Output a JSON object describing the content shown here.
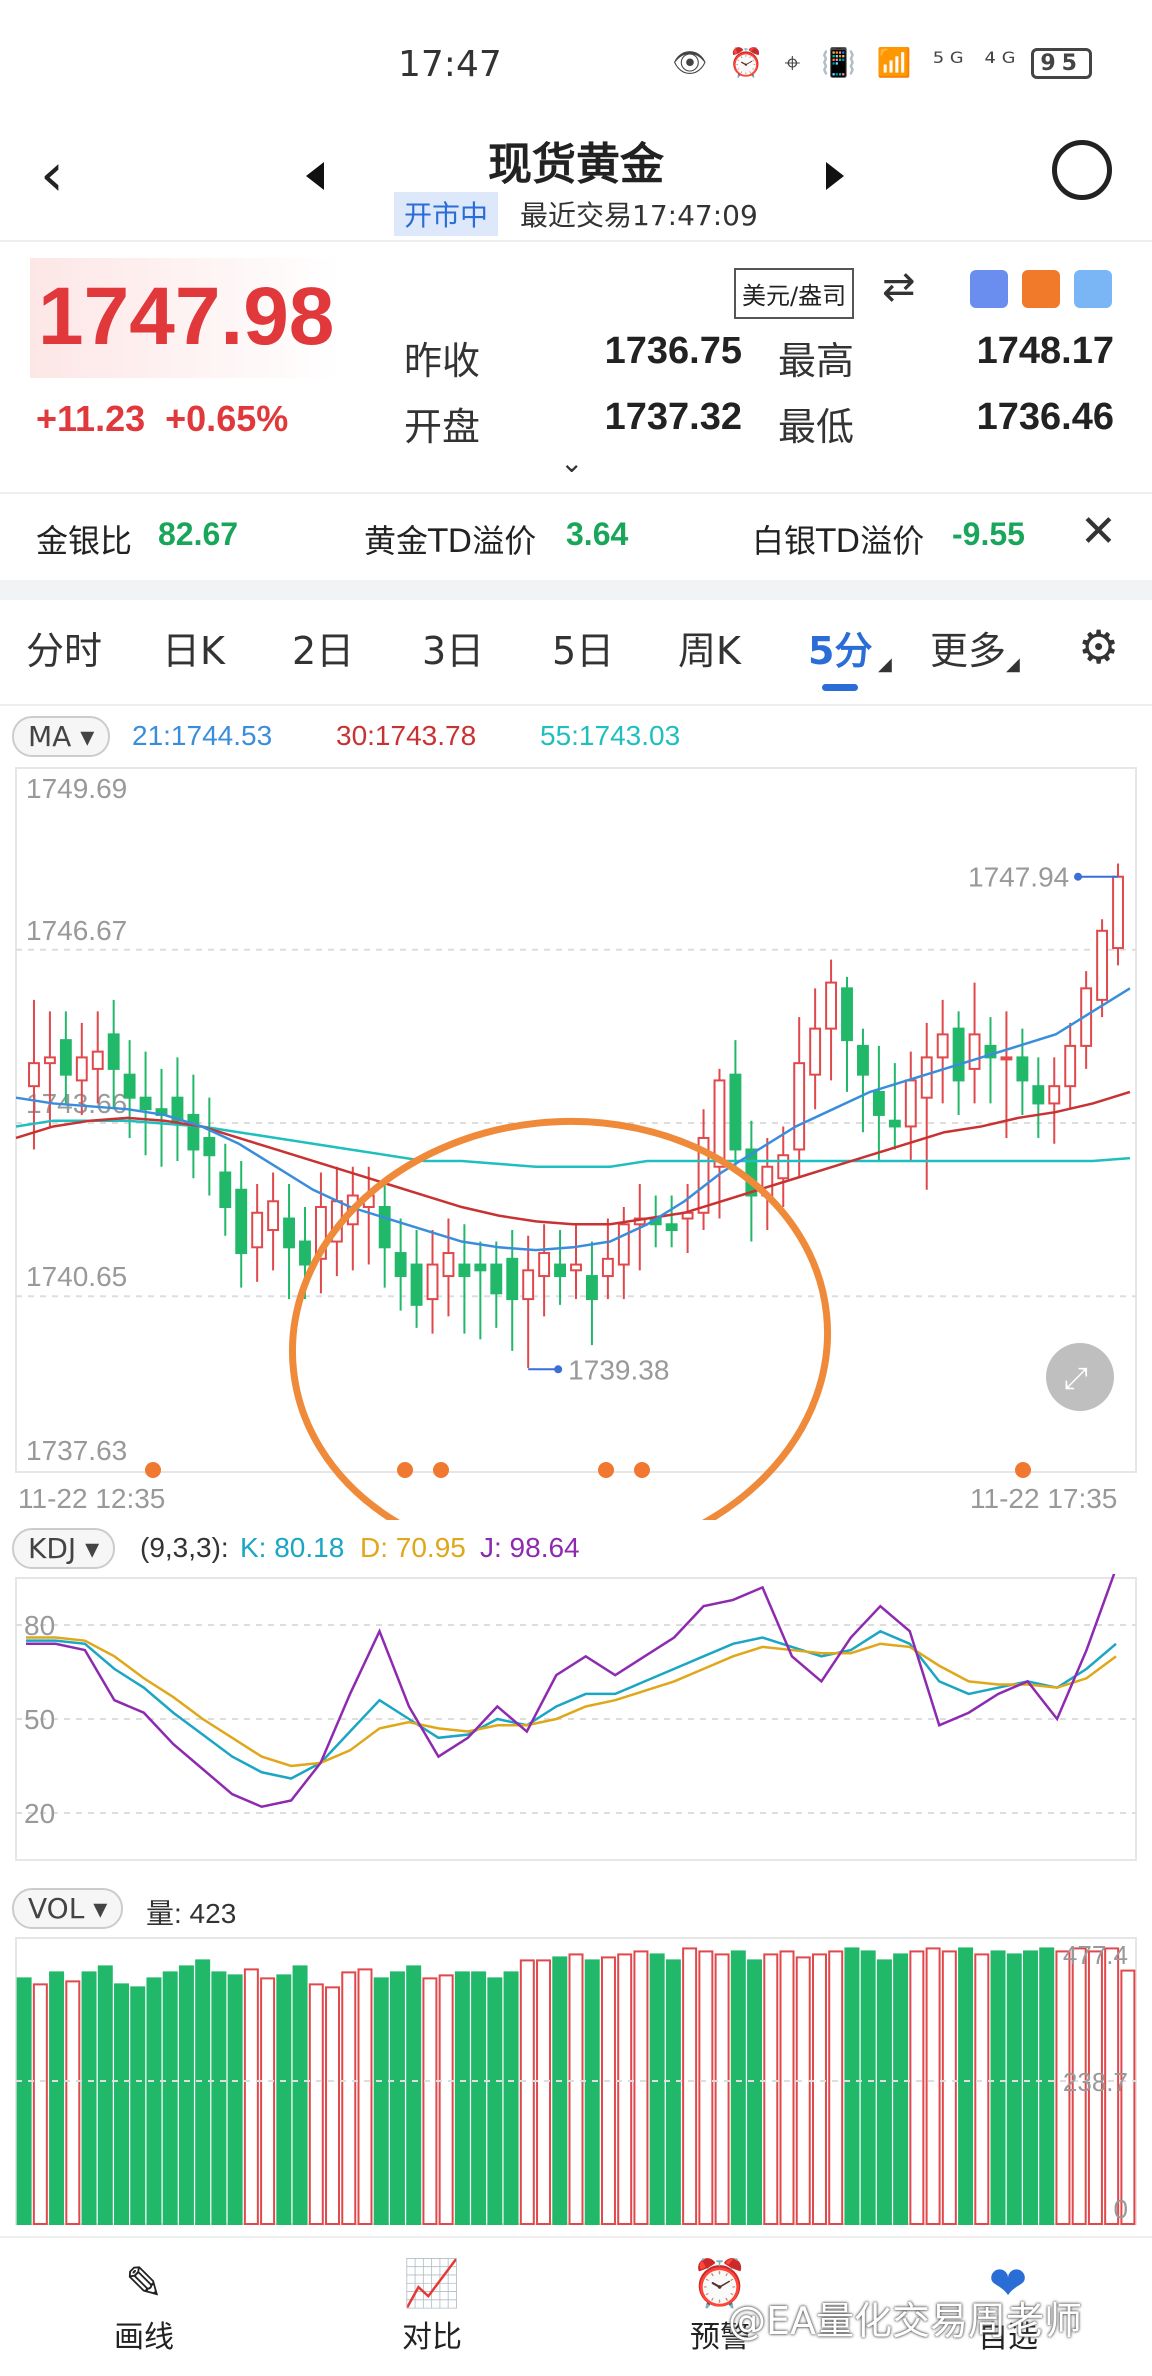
{
  "status_bar": {
    "time": "17:47",
    "icons_text": "👁 ⏰ ⌖ 📳 📶 ⁵ᴳ ⁴ᴳ",
    "battery": "95"
  },
  "header": {
    "title": "现货黄金",
    "market_state": "开市中",
    "last_trade": "最近交易17:47:09"
  },
  "quote": {
    "price": "1747.98",
    "change": "+11.23",
    "change_pct": "+0.65%",
    "unit": "美元/盎司",
    "prev_close_label": "昨收",
    "prev_close": "1736.75",
    "high_label": "最高",
    "high": "1748.17",
    "open_label": "开盘",
    "open": "1737.32",
    "low_label": "最低",
    "low": "1736.46"
  },
  "ratios": [
    {
      "label": "金银比",
      "value": "82.67"
    },
    {
      "label": "黄金TD溢价",
      "value": "3.64"
    },
    {
      "label": "白银TD溢价",
      "value": "-9.55"
    }
  ],
  "tabs": [
    "分时",
    "日K",
    "2日",
    "3日",
    "5日",
    "周K",
    "5分",
    "更多"
  ],
  "active_tab": "5分",
  "ma_panel": {
    "selector": "MA ▾",
    "ma21": "21:1744.53",
    "ma30": "30:1743.78",
    "ma55": "55:1743.03",
    "colors": {
      "ma21": "#3a8ddb",
      "ma30": "#c83232",
      "ma55": "#1fbfbf"
    }
  },
  "kdj_panel": {
    "selector": "KDJ ▾",
    "params": "(9,3,3):",
    "k": "K: 80.18",
    "d": "D: 70.95",
    "j": "J: 98.64"
  },
  "vol_panel": {
    "selector": "VOL ▾",
    "amount": "量: 423"
  },
  "nav": [
    {
      "icon": "pen-icon",
      "label": "画线"
    },
    {
      "icon": "compare-icon",
      "label": "对比"
    },
    {
      "icon": "alarm-icon",
      "label": "预警"
    },
    {
      "icon": "heart-icon",
      "label": "自选"
    }
  ],
  "watermark": "@EA量化交易周老师",
  "chart_data": [
    {
      "type": "candlestick",
      "title": "",
      "y_ticks": [
        "1749.69",
        "1746.67",
        "1743.66",
        "1740.65",
        "1737.63"
      ],
      "ylim": [
        1737.63,
        1749.69
      ],
      "x_labels": [
        "11-22 12:35",
        "11-22 17:35"
      ],
      "annotations": {
        "last": "1747.94",
        "min": "1739.38"
      },
      "candles": [
        [
          1744.3,
          1744.7,
          1745.8,
          1743.2
        ],
        [
          1744.7,
          1744.8,
          1745.6,
          1743.6
        ],
        [
          1745.1,
          1744.5,
          1745.6,
          1744.0
        ],
        [
          1744.4,
          1744.8,
          1745.4,
          1743.8
        ],
        [
          1744.6,
          1744.9,
          1745.6,
          1744.0
        ],
        [
          1745.2,
          1744.6,
          1745.8,
          1743.9
        ],
        [
          1744.5,
          1744.1,
          1745.1,
          1743.4
        ],
        [
          1744.1,
          1743.9,
          1744.9,
          1743.1
        ],
        [
          1743.9,
          1743.8,
          1744.6,
          1742.9
        ],
        [
          1744.1,
          1743.7,
          1744.8,
          1743.0
        ],
        [
          1743.8,
          1743.2,
          1744.5,
          1742.7
        ],
        [
          1743.4,
          1743.1,
          1744.1,
          1742.4
        ],
        [
          1742.8,
          1742.2,
          1743.3,
          1741.7
        ],
        [
          1742.5,
          1741.4,
          1743.0,
          1740.8
        ],
        [
          1741.5,
          1742.1,
          1742.6,
          1740.9
        ],
        [
          1741.8,
          1742.3,
          1742.8,
          1741.1
        ],
        [
          1742.0,
          1741.5,
          1742.6,
          1740.6
        ],
        [
          1741.6,
          1741.2,
          1742.2,
          1740.6
        ],
        [
          1741.3,
          1742.2,
          1742.8,
          1740.7
        ],
        [
          1741.6,
          1742.3,
          1742.9,
          1741.0
        ],
        [
          1741.9,
          1742.4,
          1742.9,
          1741.1
        ],
        [
          1742.2,
          1742.4,
          1742.9,
          1741.2
        ],
        [
          1742.2,
          1741.5,
          1742.6,
          1740.8
        ],
        [
          1741.4,
          1741.0,
          1742.0,
          1740.4
        ],
        [
          1741.2,
          1740.5,
          1741.8,
          1740.1
        ],
        [
          1740.6,
          1741.2,
          1741.8,
          1740.0
        ],
        [
          1741.0,
          1741.4,
          1742.0,
          1740.3
        ],
        [
          1741.2,
          1741.0,
          1741.9,
          1740.0
        ],
        [
          1741.2,
          1741.1,
          1741.6,
          1739.9
        ],
        [
          1741.2,
          1740.7,
          1741.6,
          1740.1
        ],
        [
          1741.3,
          1740.6,
          1741.8,
          1739.7
        ],
        [
          1740.6,
          1741.1,
          1741.7,
          1739.4
        ],
        [
          1741.0,
          1741.4,
          1741.9,
          1740.3
        ],
        [
          1741.2,
          1741.0,
          1741.8,
          1740.5
        ],
        [
          1741.1,
          1741.2,
          1741.9,
          1740.6
        ],
        [
          1741.0,
          1740.6,
          1741.6,
          1739.8
        ],
        [
          1741.0,
          1741.3,
          1742.0,
          1740.6
        ],
        [
          1741.2,
          1741.9,
          1742.2,
          1740.6
        ],
        [
          1741.9,
          1742.0,
          1742.6,
          1741.1
        ],
        [
          1742.0,
          1741.9,
          1742.4,
          1741.5
        ],
        [
          1741.9,
          1741.8,
          1742.4,
          1741.5
        ],
        [
          1742.0,
          1742.1,
          1742.6,
          1741.4
        ],
        [
          1742.1,
          1743.4,
          1743.9,
          1741.8
        ],
        [
          1742.9,
          1744.4,
          1744.6,
          1742.0
        ],
        [
          1744.5,
          1743.2,
          1745.1,
          1742.9
        ],
        [
          1743.2,
          1742.4,
          1743.7,
          1741.6
        ],
        [
          1742.4,
          1742.9,
          1743.4,
          1741.8
        ],
        [
          1742.7,
          1743.1,
          1743.6,
          1742.2
        ],
        [
          1743.2,
          1744.7,
          1745.5,
          1742.7
        ],
        [
          1744.5,
          1745.3,
          1746.0,
          1743.9
        ],
        [
          1745.3,
          1746.1,
          1746.5,
          1744.4
        ],
        [
          1746.0,
          1745.1,
          1746.2,
          1744.2
        ],
        [
          1745.0,
          1744.5,
          1745.3,
          1743.5
        ],
        [
          1744.2,
          1743.8,
          1745.0,
          1743.0
        ],
        [
          1743.7,
          1743.6,
          1744.7,
          1743.2
        ],
        [
          1743.6,
          1744.4,
          1744.9,
          1743.0
        ],
        [
          1744.1,
          1744.8,
          1745.4,
          1742.5
        ],
        [
          1744.8,
          1745.2,
          1745.8,
          1744.0
        ],
        [
          1745.3,
          1744.4,
          1745.6,
          1743.8
        ],
        [
          1744.6,
          1745.2,
          1746.1,
          1744.0
        ],
        [
          1745.0,
          1744.8,
          1745.5,
          1744.0
        ],
        [
          1744.8,
          1744.8,
          1745.6,
          1743.4
        ],
        [
          1744.8,
          1744.4,
          1745.3,
          1743.8
        ],
        [
          1744.3,
          1744.0,
          1744.8,
          1743.4
        ],
        [
          1744.0,
          1744.3,
          1744.8,
          1743.3
        ],
        [
          1744.3,
          1745.0,
          1745.4,
          1743.9
        ],
        [
          1745.0,
          1746.0,
          1746.3,
          1744.6
        ],
        [
          1745.8,
          1747.0,
          1747.2,
          1745.5
        ],
        [
          1746.7,
          1747.94,
          1748.17,
          1746.4
        ]
      ],
      "ma": {
        "ma21": [
          1744.1,
          1744.0,
          1743.95,
          1743.9,
          1743.8,
          1743.6,
          1743.3,
          1742.9,
          1742.5,
          1742.2,
          1742.0,
          1741.8,
          1741.6,
          1741.5,
          1741.45,
          1741.5,
          1741.6,
          1741.9,
          1742.3,
          1742.8,
          1743.2,
          1743.6,
          1743.9,
          1744.2,
          1744.4,
          1744.6,
          1744.8,
          1745.0,
          1745.2,
          1745.6,
          1746.0
        ],
        "ma30": [
          1743.4,
          1743.6,
          1743.7,
          1743.75,
          1743.7,
          1743.6,
          1743.4,
          1743.2,
          1743.0,
          1742.8,
          1742.6,
          1742.4,
          1742.2,
          1742.05,
          1741.95,
          1741.9,
          1741.9,
          1742.0,
          1742.1,
          1742.3,
          1742.5,
          1742.7,
          1742.9,
          1743.1,
          1743.3,
          1743.5,
          1743.6,
          1743.75,
          1743.85,
          1744.0,
          1744.2
        ],
        "ma55": [
          1743.6,
          1743.7,
          1743.7,
          1743.7,
          1743.65,
          1743.6,
          1743.5,
          1743.4,
          1743.3,
          1743.2,
          1743.1,
          1743.0,
          1743.0,
          1742.95,
          1742.9,
          1742.9,
          1742.9,
          1743.0,
          1743.0,
          1743.0,
          1743.0,
          1743.0,
          1743.0,
          1743.0,
          1743.0,
          1743.0,
          1743.0,
          1743.0,
          1743.0,
          1743.0,
          1743.05
        ]
      },
      "markers": [
        "dot-1",
        "dot-2",
        "dot-3",
        "dot-4",
        "dot-5",
        "dot-6"
      ]
    },
    {
      "type": "line",
      "title": "KDJ",
      "y_ticks": [
        "80",
        "50",
        "20"
      ],
      "ylim": [
        5,
        95
      ],
      "series": [
        {
          "name": "K",
          "color": "#1aa6c4",
          "values": [
            75,
            75,
            74,
            66,
            60,
            52,
            45,
            38,
            33,
            31,
            36,
            46,
            56,
            50,
            44,
            45,
            50,
            48,
            54,
            58,
            58,
            62,
            66,
            70,
            74,
            76,
            73,
            70,
            72,
            78,
            74,
            62,
            58,
            60,
            62,
            60,
            66,
            74
          ]
        },
        {
          "name": "D",
          "color": "#e0a71a",
          "values": [
            76,
            76,
            75,
            70,
            63,
            57,
            50,
            44,
            38,
            35,
            36,
            40,
            47,
            49,
            47,
            46,
            48,
            48,
            50,
            54,
            56,
            59,
            62,
            66,
            70,
            73,
            72,
            71,
            71,
            74,
            73,
            67,
            62,
            61,
            61,
            60,
            63,
            70
          ]
        },
        {
          "name": "J",
          "color": "#8e2ab0",
          "values": [
            74,
            74,
            72,
            56,
            52,
            42,
            34,
            26,
            22,
            24,
            36,
            58,
            78,
            54,
            38,
            44,
            54,
            46,
            64,
            70,
            64,
            70,
            76,
            86,
            88,
            92,
            70,
            62,
            76,
            86,
            78,
            48,
            52,
            58,
            62,
            50,
            72,
            98
          ]
        }
      ]
    },
    {
      "type": "bar",
      "title": "VOL",
      "y_ticks": [
        "477.4",
        "238.7",
        "0"
      ],
      "ylim": [
        0,
        477.4
      ],
      "values": [
        410,
        400,
        420,
        405,
        420,
        430,
        400,
        395,
        410,
        420,
        430,
        440,
        420,
        415,
        425,
        410,
        415,
        430,
        400,
        395,
        420,
        425,
        410,
        420,
        430,
        410,
        415,
        420,
        420,
        410,
        420,
        440,
        440,
        445,
        450,
        440,
        445,
        450,
        455,
        450,
        440,
        460,
        455,
        450,
        455,
        440,
        450,
        455,
        445,
        450,
        455,
        460,
        455,
        440,
        450,
        455,
        460,
        455,
        460,
        450,
        455,
        450,
        455,
        460,
        455,
        460,
        455,
        460,
        423
      ],
      "up": [
        0,
        1,
        0,
        1,
        0,
        0,
        0,
        0,
        0,
        0,
        0,
        0,
        0,
        0,
        1,
        1,
        0,
        0,
        1,
        1,
        1,
        1,
        0,
        0,
        0,
        1,
        1,
        0,
        0,
        0,
        0,
        1,
        1,
        0,
        1,
        0,
        1,
        1,
        1,
        0,
        0,
        1,
        1,
        1,
        0,
        0,
        1,
        1,
        1,
        1,
        1,
        0,
        0,
        0,
        0,
        1,
        1,
        1,
        0,
        1,
        0,
        0,
        0,
        0,
        1,
        1,
        1,
        1,
        1
      ]
    }
  ]
}
